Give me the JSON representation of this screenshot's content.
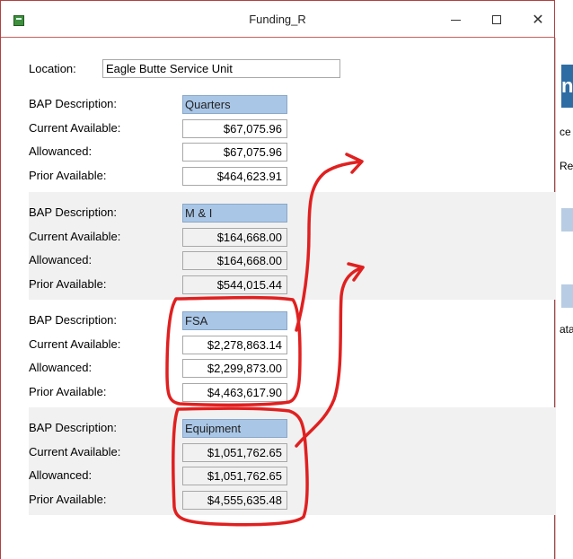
{
  "window": {
    "title": "Funding_R"
  },
  "location": {
    "label": "Location:",
    "value": "Eagle Butte Service Unit"
  },
  "labels": {
    "description": "BAP Description:",
    "current": "Current Available:",
    "allowanced": "Allowanced:",
    "prior": "Prior Available:"
  },
  "sections": [
    {
      "description": "Quarters",
      "current": "$67,075.96",
      "allowanced": "$67,075.96",
      "prior": "$464,623.91"
    },
    {
      "description": "M & I",
      "current": "$164,668.00",
      "allowanced": "$164,668.00",
      "prior": "$544,015.44"
    },
    {
      "description": "FSA",
      "current": "$2,278,863.14",
      "allowanced": "$2,299,873.00",
      "prior": "$4,463,617.90"
    },
    {
      "description": "Equipment",
      "current": "$1,051,762.65",
      "allowanced": "$1,051,762.65",
      "prior": "$4,555,635.48"
    }
  ],
  "background_window": {
    "header_text": "ng",
    "rows": [
      "ce",
      "Re",
      "ata"
    ]
  },
  "colors": {
    "annotation": "#e02020",
    "description_fill": "#a9c6e6",
    "shade": "#f1f1f1"
  }
}
